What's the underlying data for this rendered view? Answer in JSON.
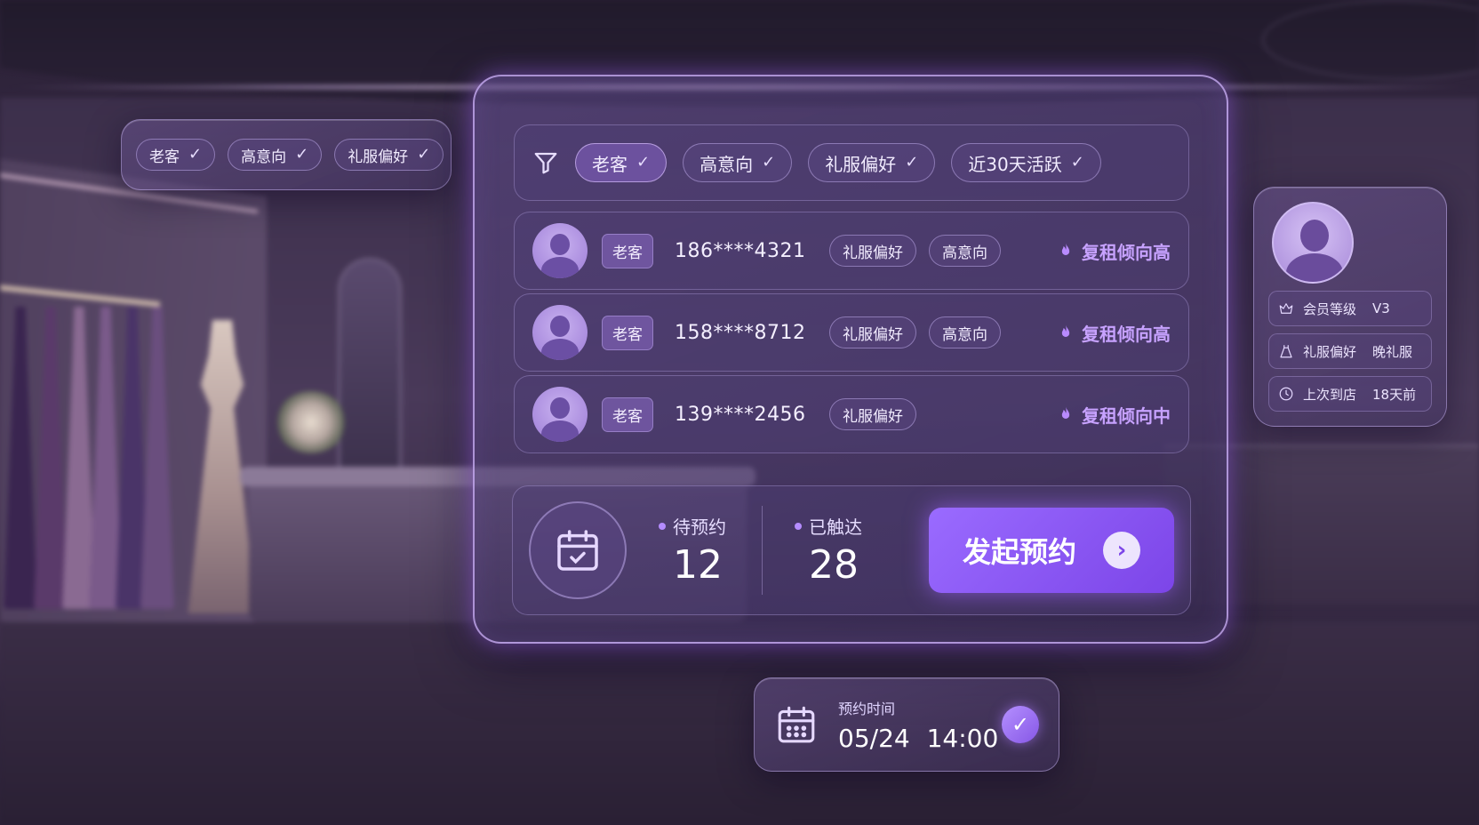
{
  "left_filter": {
    "chips": [
      {
        "label": "老客",
        "check": "✓"
      },
      {
        "label": "高意向",
        "check": "✓"
      },
      {
        "label": "礼服偏好",
        "check": "✓"
      }
    ]
  },
  "filter_bar": {
    "icon": "filter-icon",
    "chips": [
      {
        "label": "老客",
        "check": "✓"
      },
      {
        "label": "高意向",
        "check": "✓"
      },
      {
        "label": "礼服偏好",
        "check": "✓"
      },
      {
        "label": "近30天活跃",
        "check": "✓"
      }
    ]
  },
  "customers": [
    {
      "badge": "老客",
      "phone": "186****4321",
      "tags": [
        "礼服偏好",
        "高意向"
      ],
      "trend": "复租倾向高"
    },
    {
      "badge": "老客",
      "phone": "158****8712",
      "tags": [
        "礼服偏好",
        "高意向"
      ],
      "trend": "复租倾向高"
    },
    {
      "badge": "老客",
      "phone": "139****2456",
      "tags": [
        "礼服偏好"
      ],
      "trend": "复租倾向中"
    }
  ],
  "stats": {
    "pending": {
      "label": "待预约",
      "value": "12"
    },
    "reached": {
      "label": "已触达",
      "value": "28"
    }
  },
  "cta": {
    "label": "发起预约",
    "arrow": "›"
  },
  "profile": {
    "items": [
      {
        "icon": "crown-icon",
        "label": "会员等级",
        "value": "V3"
      },
      {
        "icon": "dress-icon",
        "label": "礼服偏好",
        "value": "晚礼服"
      },
      {
        "icon": "clock-icon",
        "label": "上次到店",
        "value": "18天前"
      }
    ]
  },
  "appointment": {
    "label": "预约时间",
    "value": "05/24 14:00",
    "check": "✓"
  },
  "colors": {
    "accent": "#8a55f0",
    "trend_text": "#c7a2ff",
    "background": "#3b2d4a"
  }
}
